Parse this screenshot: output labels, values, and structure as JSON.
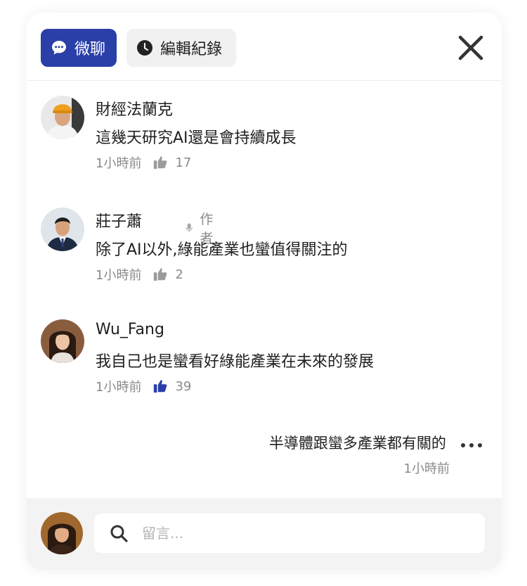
{
  "header": {
    "tabs": [
      {
        "label": "微聊",
        "icon": "chat-bubble-icon",
        "active": true
      },
      {
        "label": "編輯紀錄",
        "icon": "clock-icon",
        "active": false
      }
    ],
    "close_icon": "close-icon"
  },
  "comments": [
    {
      "name": "財經法蘭克",
      "text": "這幾天研究AI還是會持續成長",
      "time": "1小時前",
      "likes": "17",
      "liked": false,
      "is_author": false
    },
    {
      "name": "莊子蕭",
      "author_label": "作者",
      "text": "除了AI以外,綠能產業也蠻值得關注的",
      "time": "1小時前",
      "likes": "2",
      "liked": false,
      "is_author": true
    },
    {
      "name": "Wu_Fang",
      "text": "我自己也是蠻看好綠能產業在未來的發展",
      "time": "1小時前",
      "likes": "39",
      "liked": true,
      "is_author": false
    }
  ],
  "own_comment": {
    "text": "半導體跟蠻多產業都有關的",
    "time": "1小時前"
  },
  "composer": {
    "placeholder": "留言..."
  },
  "colors": {
    "accent": "#2a3fa8",
    "muted": "#8a8a8a",
    "like_inactive": "#9b9b9b"
  }
}
